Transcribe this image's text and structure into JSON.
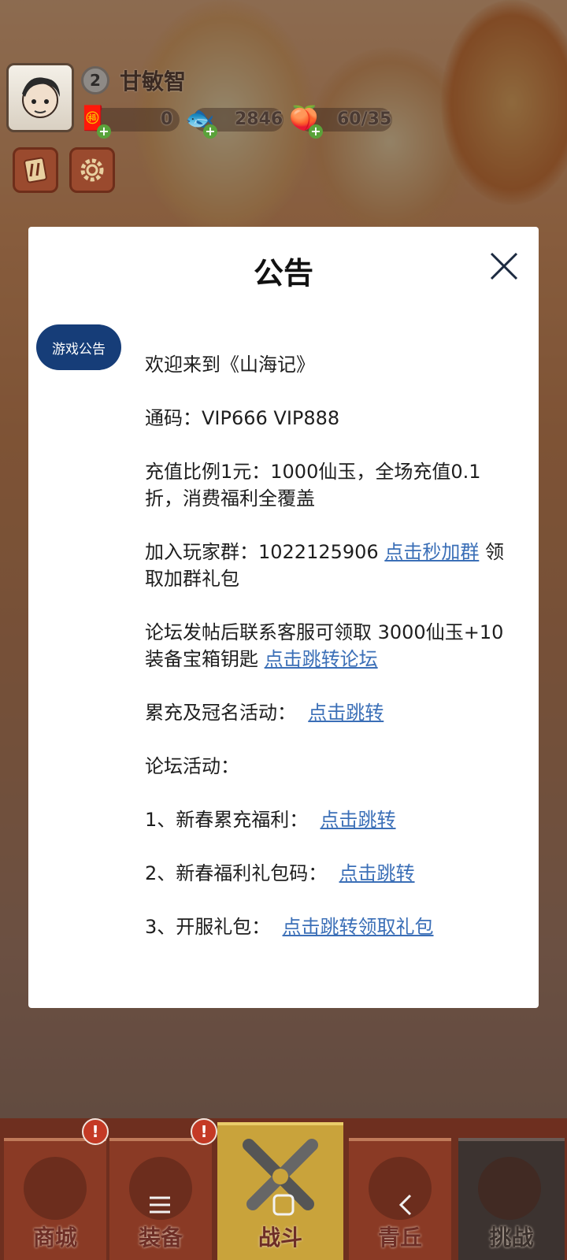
{
  "player": {
    "level": "2",
    "name": "甘敏智"
  },
  "resources": [
    {
      "name": "ticket",
      "value": "0"
    },
    {
      "name": "fish",
      "value": "2846"
    },
    {
      "name": "peach",
      "value": "60/35"
    }
  ],
  "dialog": {
    "title": "公告",
    "tab": "游戏公告",
    "lines": {
      "welcome": "欢迎来到《山海记》",
      "code": "通码：VIP666 VIP888",
      "recharge": "充值比例1元：1000仙玉，全场充值0.1折，消费福利全覆盖",
      "group_prefix": "加入玩家群：1022125906 ",
      "group_link": "点击秒加群",
      "group_suffix": " 领取加群礼包",
      "forum_prefix": "论坛发帖后联系客服可领取 3000仙玉+10装备宝箱钥匙 ",
      "forum_link": "点击跳转论坛",
      "cumulative_prefix": "累充及冠名活动：  ",
      "cumulative_link": "点击跳转",
      "forum_activity": "论坛活动：",
      "item1_prefix": "1、新春累充福利：  ",
      "item1_link": "点击跳转",
      "item2_prefix": "2、新春福利礼包码：  ",
      "item2_link": "点击跳转",
      "item3_prefix": "3、开服礼包：  ",
      "item3_link": "点击跳转领取礼包"
    }
  },
  "bottom_nav": [
    {
      "label": "商城"
    },
    {
      "label": "装备"
    },
    {
      "label": "战斗"
    },
    {
      "label": "青丘"
    },
    {
      "label": "挑战"
    }
  ],
  "alert_mark": "!",
  "colors": {
    "accent_tab": "#163d78",
    "link": "#3b6fb7"
  }
}
